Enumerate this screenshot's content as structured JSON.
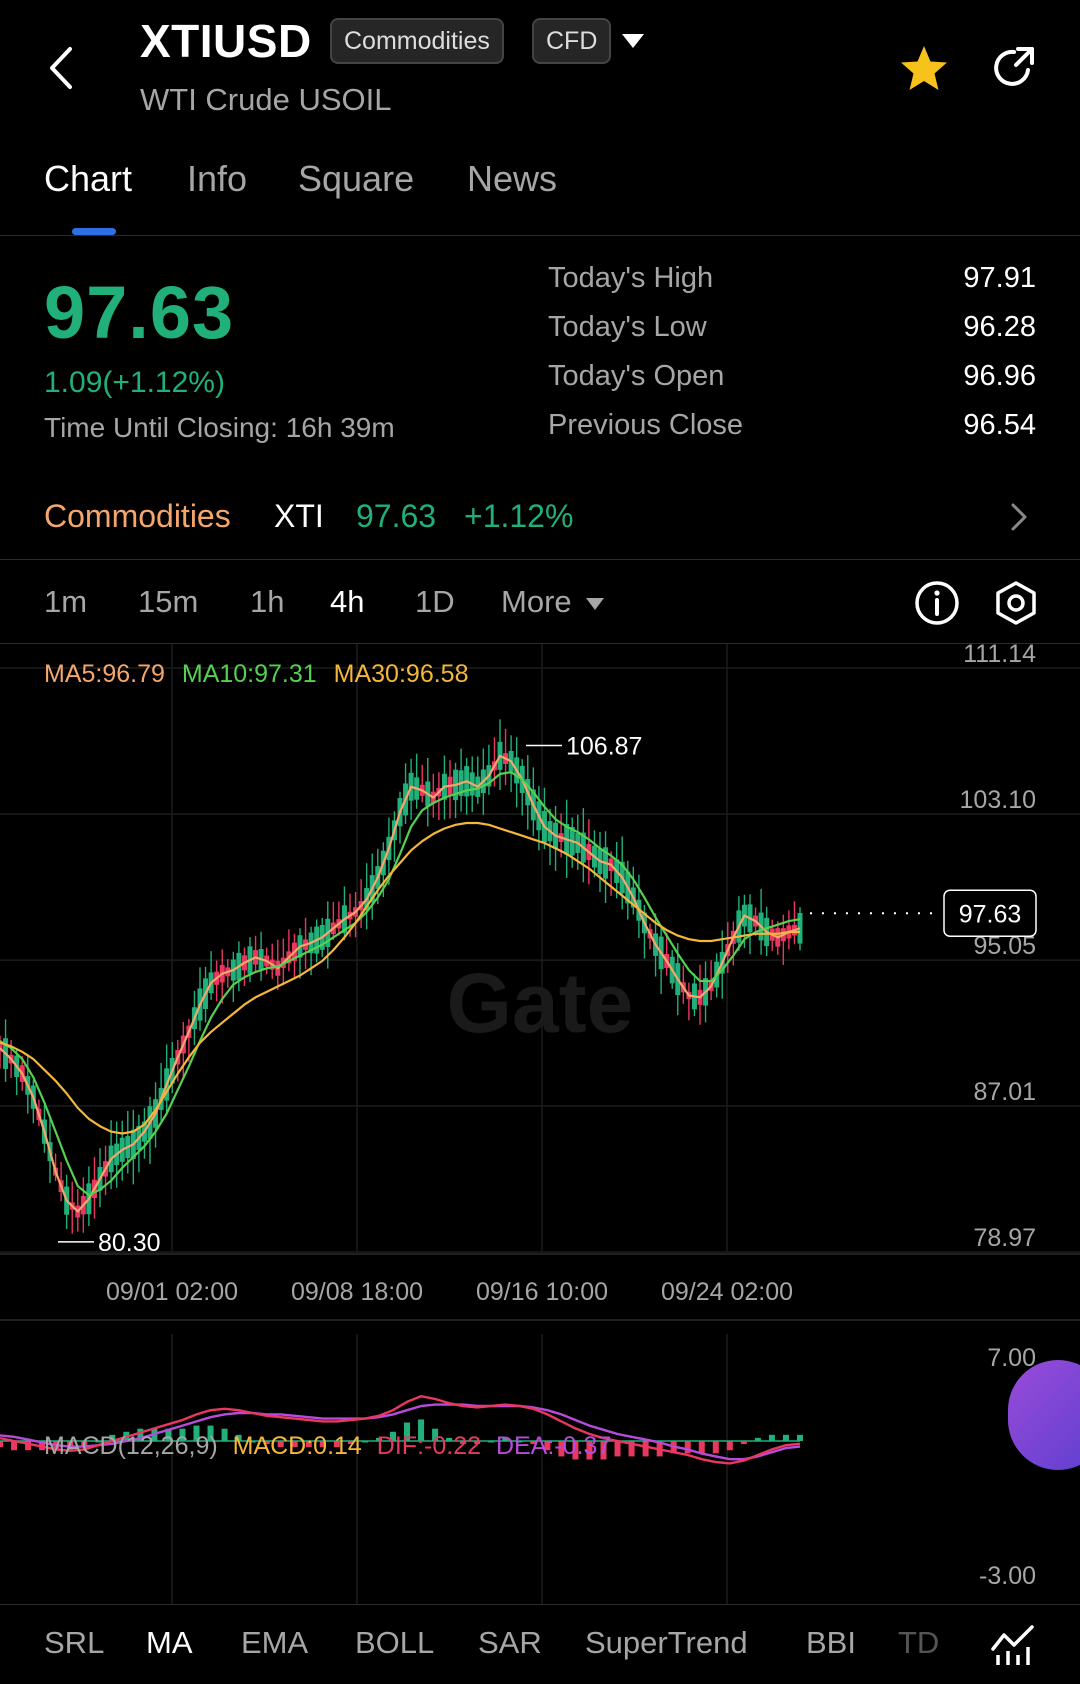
{
  "header": {
    "symbol": "XTIUSD",
    "tag_market": "Commodities",
    "tag_type": "CFD",
    "subtitle": "WTI Crude USOIL"
  },
  "tabs": [
    {
      "label": "Chart",
      "active": true
    },
    {
      "label": "Info",
      "active": false
    },
    {
      "label": "Square",
      "active": false
    },
    {
      "label": "News",
      "active": false
    }
  ],
  "quote": {
    "price": "97.63",
    "change": "1.09(+1.12%)",
    "closing_label": "Time Until Closing:",
    "closing_value": "16h 39m",
    "stats": [
      {
        "label": "Today's High",
        "value": "97.91"
      },
      {
        "label": "Today's Low",
        "value": "96.28"
      },
      {
        "label": "Today's Open",
        "value": "96.96"
      },
      {
        "label": "Previous Close",
        "value": "96.54"
      }
    ]
  },
  "sector": {
    "name": "Commodities",
    "symbol": "XTI",
    "price": "97.63",
    "change": "+1.12%"
  },
  "intervals": [
    {
      "label": "1m",
      "active": false
    },
    {
      "label": "15m",
      "active": false
    },
    {
      "label": "1h",
      "active": false
    },
    {
      "label": "4h",
      "active": true
    },
    {
      "label": "1D",
      "active": false
    },
    {
      "label": "More",
      "active": false
    }
  ],
  "ma_legend": {
    "ma5": "MA5:96.79",
    "ma10": "MA10:97.31",
    "ma30": "MA30:96.58"
  },
  "macd_legend": {
    "title": "MACD(12,26,9)",
    "macd": "MACD:0.14",
    "dif": "DIF:-0.22",
    "dea": "DEA:-0.37"
  },
  "watermark": "Gate",
  "colors": {
    "up": "#21b07a",
    "down": "#e8385f",
    "ma5": "#f5a66c",
    "ma10": "#55d050",
    "ma30": "#f4b63b",
    "dif": "#e8385f",
    "dea": "#b84bdb",
    "star": "#f7c21b"
  },
  "indicators": [
    {
      "label": "SRL",
      "active": false
    },
    {
      "label": "MA",
      "active": true
    },
    {
      "label": "EMA",
      "active": false
    },
    {
      "label": "BOLL",
      "active": false
    },
    {
      "label": "SAR",
      "active": false
    },
    {
      "label": "SuperTrend",
      "active": false
    },
    {
      "label": "BBI",
      "active": false
    },
    {
      "label": "TD",
      "active": false
    }
  ],
  "chart_data": {
    "type": "line",
    "price_axis_ticks": [
      111.14,
      103.1,
      95.05,
      87.01,
      78.97
    ],
    "price_axis_labels": [
      "111.14",
      "103.10",
      "95.05",
      "87.01",
      "78.97"
    ],
    "ylim": [
      78.97,
      111.14
    ],
    "x_tick_labels": [
      "09/01 02:00",
      "09/08 18:00",
      "09/16 10:00",
      "09/24 02:00"
    ],
    "max_label": "106.87",
    "min_label": "80.30",
    "last_price": 97.63,
    "last_price_label": "97.63",
    "series": [
      {
        "name": "MA5",
        "values": [
          90.2,
          89.6,
          88.8,
          87.5,
          85.6,
          83.4,
          81.8,
          81.2,
          81.9,
          83.0,
          84.1,
          84.6,
          84.9,
          85.6,
          86.6,
          88.2,
          89.7,
          91.1,
          92.6,
          93.8,
          94.3,
          94.5,
          94.9,
          95.2,
          95.0,
          94.6,
          95.2,
          95.8,
          96.0,
          96.3,
          96.8,
          97.3,
          97.7,
          98.4,
          99.6,
          101.2,
          103.2,
          104.6,
          104.4,
          104.0,
          104.6,
          104.7,
          104.9,
          104.6,
          105.2,
          106.3,
          106.0,
          105.0,
          103.6,
          102.4,
          101.9,
          101.7,
          101.5,
          101.0,
          100.5,
          100.3,
          99.6,
          98.5,
          97.1,
          95.9,
          95.0,
          94.0,
          93.1,
          93.0,
          93.6,
          94.9,
          96.3,
          97.5,
          97.2,
          96.6,
          96.3,
          96.6,
          96.8
        ]
      },
      {
        "name": "MA10",
        "values": [
          90.6,
          90.2,
          89.6,
          88.6,
          87.2,
          85.6,
          84.0,
          82.6,
          82.1,
          82.4,
          82.9,
          83.6,
          84.2,
          84.8,
          85.6,
          86.6,
          87.9,
          89.2,
          90.6,
          91.9,
          92.9,
          93.7,
          94.1,
          94.4,
          94.6,
          94.7,
          95.0,
          95.3,
          95.6,
          95.9,
          96.3,
          96.7,
          97.1,
          97.7,
          98.5,
          99.5,
          100.9,
          102.4,
          103.3,
          103.7,
          104.0,
          104.2,
          104.4,
          104.5,
          104.8,
          105.3,
          105.4,
          105.0,
          104.3,
          103.5,
          102.8,
          102.4,
          102.1,
          101.7,
          101.2,
          100.8,
          100.3,
          99.5,
          98.5,
          97.4,
          96.4,
          95.4,
          94.5,
          93.9,
          93.9,
          94.5,
          95.3,
          96.2,
          96.6,
          96.8,
          97.0,
          97.2,
          97.3
        ]
      },
      {
        "name": "MA30",
        "values": [
          90.5,
          90.3,
          90.0,
          89.6,
          89.0,
          88.4,
          87.7,
          86.9,
          86.3,
          85.9,
          85.6,
          85.5,
          85.6,
          86.0,
          86.8,
          87.8,
          88.8,
          89.7,
          90.5,
          91.1,
          91.6,
          92.1,
          92.6,
          93.0,
          93.3,
          93.6,
          93.9,
          94.2,
          94.6,
          95.0,
          95.6,
          96.3,
          97.1,
          98.0,
          98.9,
          99.7,
          100.4,
          101.1,
          101.6,
          102.0,
          102.3,
          102.5,
          102.6,
          102.6,
          102.5,
          102.3,
          102.1,
          101.9,
          101.7,
          101.5,
          101.2,
          100.9,
          100.5,
          100.1,
          99.6,
          99.1,
          98.6,
          98.1,
          97.6,
          97.1,
          96.7,
          96.4,
          96.2,
          96.1,
          96.1,
          96.2,
          96.3,
          96.4,
          96.5,
          96.5,
          96.5,
          96.6,
          96.6
        ]
      }
    ],
    "macd_axis_labels": [
      "7.00",
      "-3.00"
    ],
    "macd_ylim": [
      -3.0,
      7.0
    ],
    "macd_series": [
      {
        "name": "DIF",
        "values": [
          0.2,
          0.0,
          -0.2,
          -0.4,
          -0.6,
          -0.7,
          -0.6,
          -0.3,
          0.0,
          0.3,
          0.6,
          0.9,
          1.2,
          1.5,
          1.9,
          2.2,
          2.3,
          2.2,
          2.0,
          1.8,
          1.7,
          1.6,
          1.5,
          1.4,
          1.4,
          1.5,
          1.6,
          1.8,
          2.2,
          2.8,
          3.2,
          3.0,
          2.7,
          2.5,
          2.4,
          2.5,
          2.6,
          2.5,
          2.3,
          1.9,
          1.4,
          0.9,
          0.5,
          0.2,
          0.0,
          -0.2,
          -0.4,
          -0.6,
          -0.8,
          -1.0,
          -1.3,
          -1.5,
          -1.6,
          -1.4,
          -1.0,
          -0.6,
          -0.3,
          -0.2
        ]
      },
      {
        "name": "DEA",
        "values": [
          0.4,
          0.3,
          0.1,
          -0.1,
          -0.3,
          -0.4,
          -0.4,
          -0.3,
          -0.2,
          0.0,
          0.2,
          0.5,
          0.8,
          1.1,
          1.4,
          1.7,
          1.9,
          2.0,
          2.0,
          1.9,
          1.9,
          1.8,
          1.7,
          1.6,
          1.6,
          1.6,
          1.6,
          1.7,
          1.9,
          2.2,
          2.5,
          2.6,
          2.6,
          2.6,
          2.5,
          2.5,
          2.5,
          2.5,
          2.4,
          2.2,
          1.9,
          1.5,
          1.1,
          0.8,
          0.5,
          0.3,
          0.1,
          -0.1,
          -0.4,
          -0.6,
          -0.9,
          -1.1,
          -1.3,
          -1.3,
          -1.1,
          -0.8,
          -0.5,
          -0.4
        ]
      }
    ]
  }
}
